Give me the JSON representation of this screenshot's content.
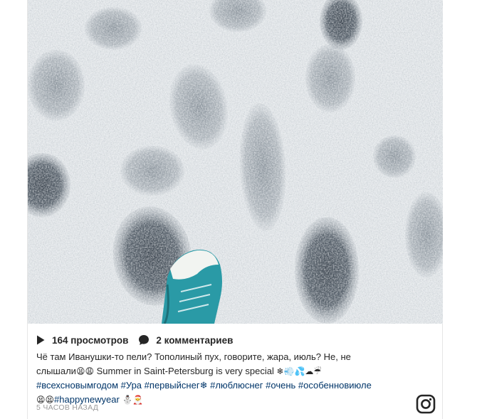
{
  "stats": {
    "views": "164 просмотров",
    "comments": "2 комментариев"
  },
  "caption": {
    "line1": "Чё там Иванушки-то пели? Тополиный пух, говорите, жара, июль? Не, не",
    "line2_text": "слышали",
    "line2_emoji": "😫😩",
    "line2_text2": " Summer in Saint-Petersburg is very special ",
    "line2_emoji2": "❄💨💦☁☔",
    "tags": [
      "#всехсновымгодом",
      "#Ура",
      "#первыйснег❄",
      "#люблюснег",
      "#очень",
      "#особенновиюле"
    ],
    "line4_emoji": "😫😫",
    "line4_tag": "#happynewyear",
    "line4_emoji2": "⛄🎅"
  },
  "timestamp": "5 ЧАСОВ НАЗАД",
  "icons": {
    "views": "play-icon",
    "comments": "comment-bubble-icon",
    "brand": "instagram-icon"
  },
  "colors": {
    "text": "#262626",
    "hashtag": "#003569",
    "timestamp": "#999999",
    "shoe": "#2a9aa6"
  }
}
